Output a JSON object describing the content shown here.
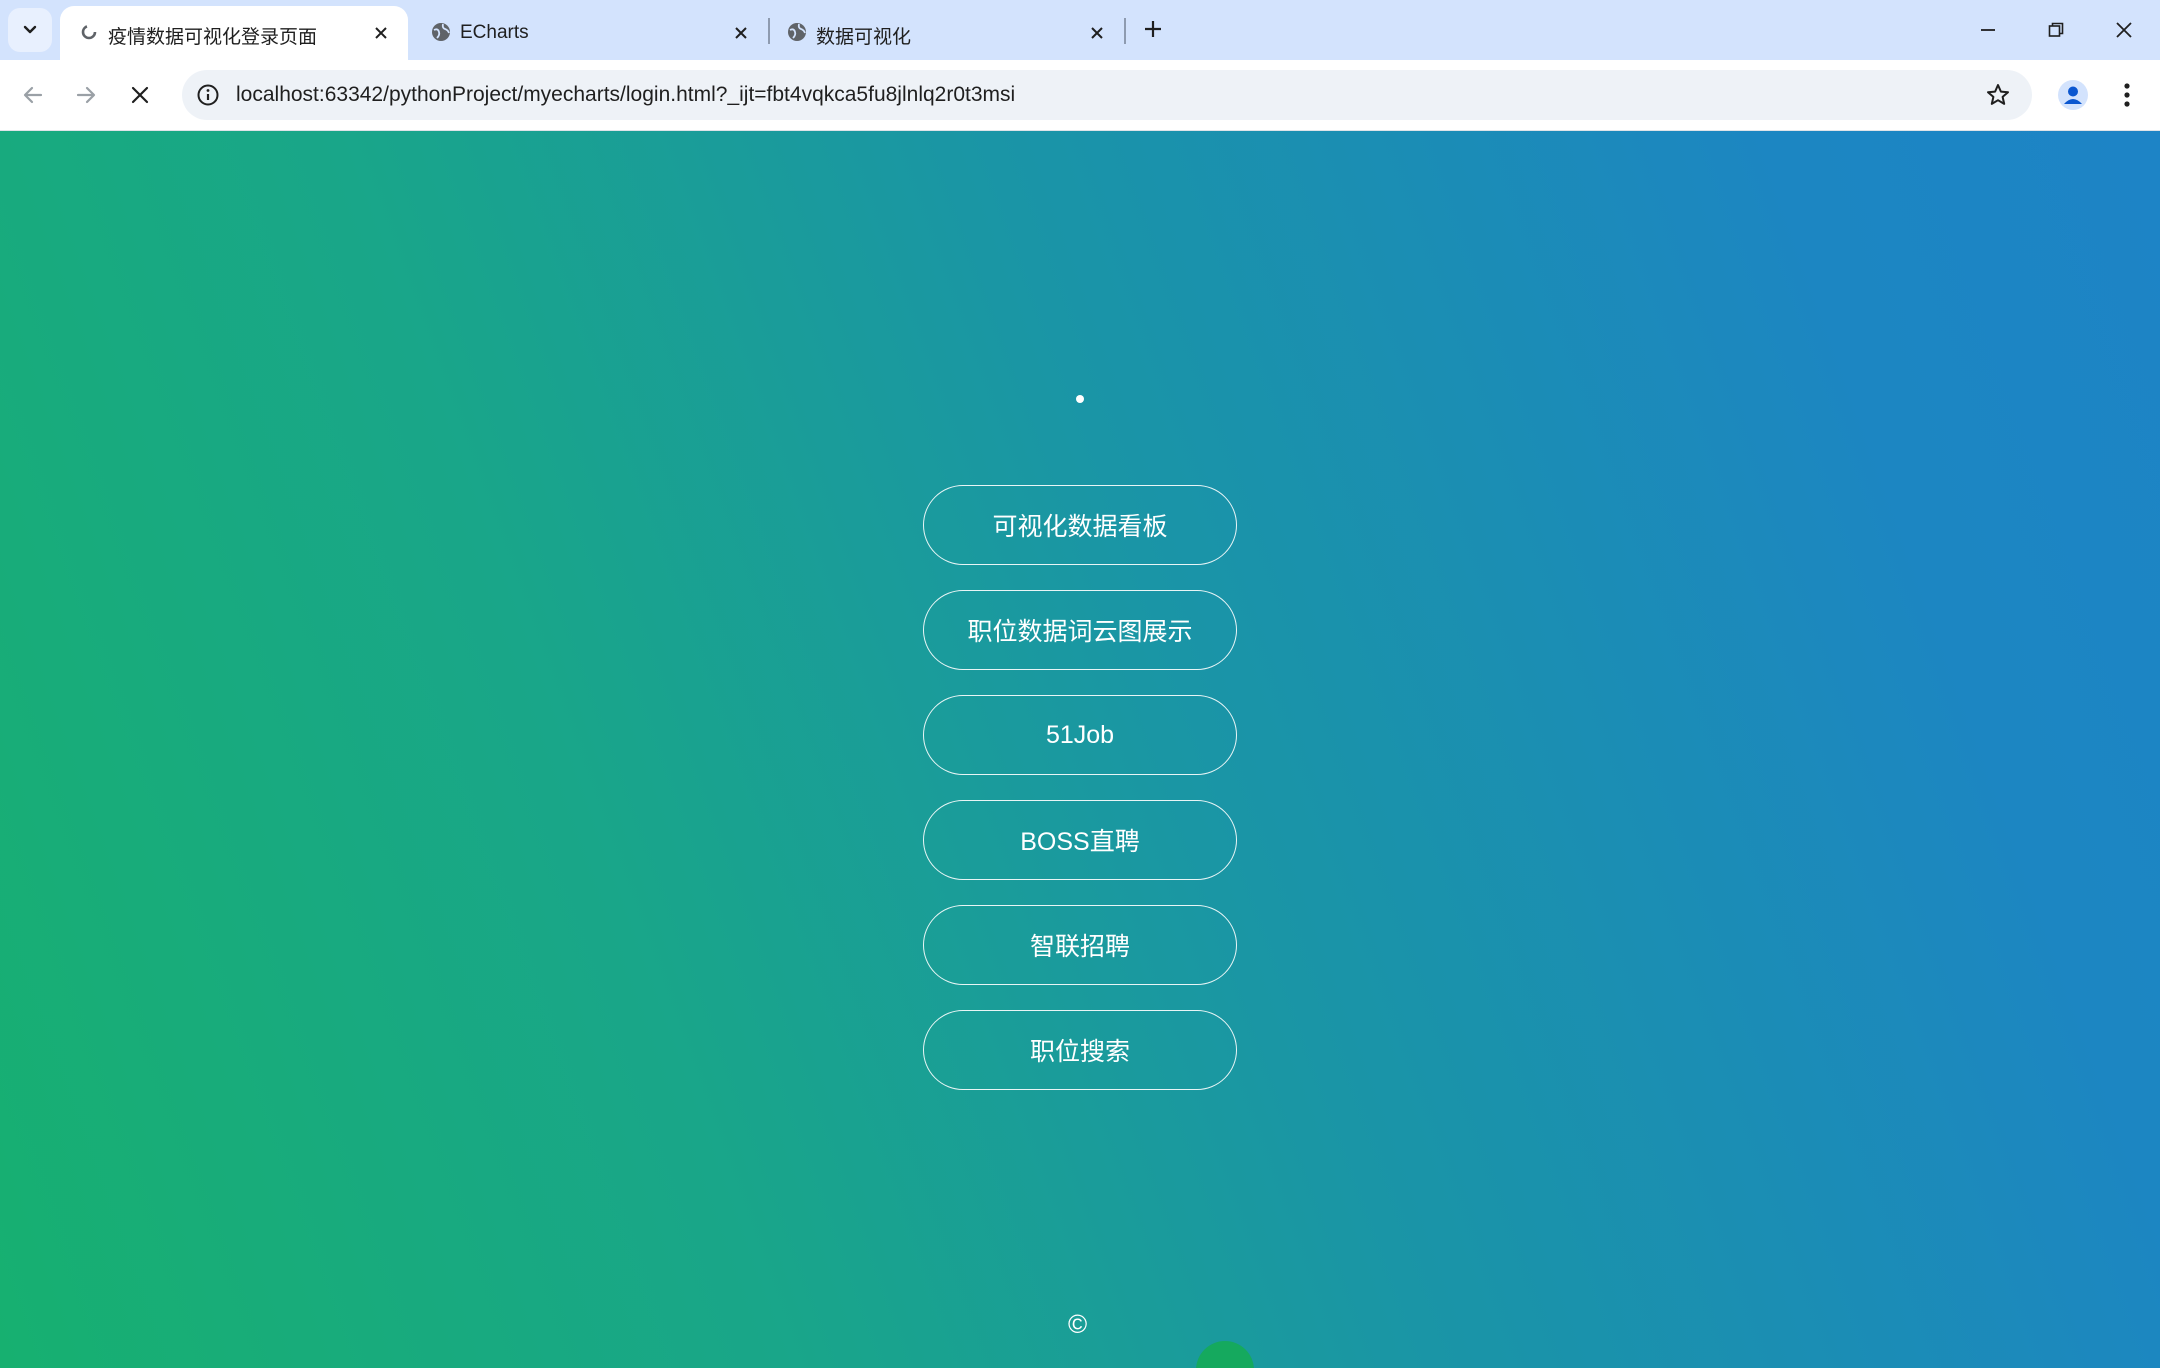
{
  "tabs": [
    {
      "title": "疫情数据可视化登录页面",
      "active": true,
      "icon": "loading-favicon-icon"
    },
    {
      "title": "ECharts",
      "active": false,
      "icon": "globe-icon"
    },
    {
      "title": "数据可视化",
      "active": false,
      "icon": "globe-icon"
    }
  ],
  "address_bar": {
    "url": "localhost:63342/pythonProject/myecharts/login.html?_ijt=fbt4vqkca5fu8jlnlq2r0t3msi"
  },
  "page": {
    "buttons": [
      {
        "label": "可视化数据看板"
      },
      {
        "label": "职位数据词云图展示"
      },
      {
        "label": "51Job"
      },
      {
        "label": "BOSS直聘"
      },
      {
        "label": "智联招聘"
      },
      {
        "label": "职位搜索"
      }
    ],
    "footer": "©"
  },
  "colors": {
    "tabstrip": "#d3e3fd",
    "gradient_start": "#17b070",
    "gradient_end": "#1d84c6"
  }
}
